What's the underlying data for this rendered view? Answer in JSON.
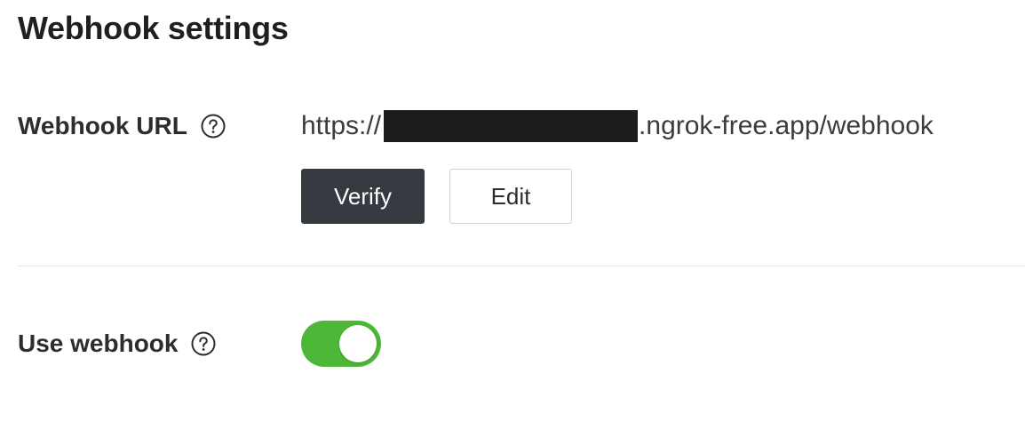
{
  "page": {
    "title": "Webhook settings"
  },
  "webhook_url": {
    "label": "Webhook URL",
    "help_icon": "question-circle-icon",
    "url_prefix": "https://",
    "url_suffix": ".ngrok-free.app/webhook",
    "redacted": true,
    "verify_label": "Verify",
    "edit_label": "Edit"
  },
  "use_webhook": {
    "label": "Use webhook",
    "help_icon": "question-circle-icon",
    "enabled": true
  },
  "colors": {
    "toggle_on": "#4cb637",
    "primary_button": "#363a40",
    "text": "#2b2d30"
  }
}
